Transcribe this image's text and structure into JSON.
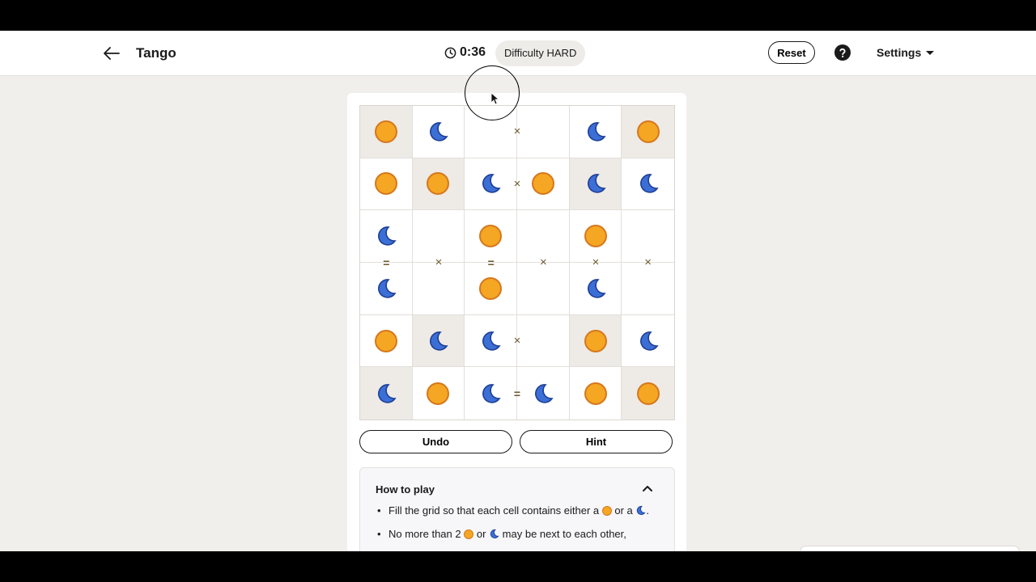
{
  "header": {
    "title": "Tango",
    "timer": "0:36",
    "difficulty": "Difficulty HARD",
    "reset_label": "Reset",
    "settings_label": "Settings"
  },
  "board": {
    "size": 6,
    "cells": [
      [
        {
          "v": "sun",
          "locked": true
        },
        {
          "v": "moon",
          "locked": false
        },
        {
          "v": "",
          "locked": false
        },
        {
          "v": "",
          "locked": false
        },
        {
          "v": "moon",
          "locked": false
        },
        {
          "v": "sun",
          "locked": true
        }
      ],
      [
        {
          "v": "sun",
          "locked": false
        },
        {
          "v": "sun",
          "locked": true
        },
        {
          "v": "moon",
          "locked": false
        },
        {
          "v": "sun",
          "locked": false
        },
        {
          "v": "moon",
          "locked": true
        },
        {
          "v": "moon",
          "locked": false
        }
      ],
      [
        {
          "v": "moon",
          "locked": false
        },
        {
          "v": "",
          "locked": false
        },
        {
          "v": "sun",
          "locked": false
        },
        {
          "v": "",
          "locked": false
        },
        {
          "v": "sun",
          "locked": false
        },
        {
          "v": "",
          "locked": false
        }
      ],
      [
        {
          "v": "moon",
          "locked": false
        },
        {
          "v": "",
          "locked": false
        },
        {
          "v": "sun",
          "locked": false
        },
        {
          "v": "",
          "locked": false
        },
        {
          "v": "moon",
          "locked": false
        },
        {
          "v": "",
          "locked": false
        }
      ],
      [
        {
          "v": "sun",
          "locked": false
        },
        {
          "v": "moon",
          "locked": true
        },
        {
          "v": "moon",
          "locked": false
        },
        {
          "v": "",
          "locked": false
        },
        {
          "v": "sun",
          "locked": true
        },
        {
          "v": "moon",
          "locked": false
        }
      ],
      [
        {
          "v": "moon",
          "locked": true
        },
        {
          "v": "sun",
          "locked": false
        },
        {
          "v": "moon",
          "locked": false
        },
        {
          "v": "moon",
          "locked": false
        },
        {
          "v": "sun",
          "locked": false
        },
        {
          "v": "sun",
          "locked": true
        }
      ]
    ],
    "constraints": [
      {
        "row": 0,
        "col": 2,
        "dir": "right",
        "type": "cross"
      },
      {
        "row": 1,
        "col": 2,
        "dir": "right",
        "type": "cross"
      },
      {
        "row": 2,
        "col": 0,
        "dir": "down",
        "type": "equal"
      },
      {
        "row": 2,
        "col": 1,
        "dir": "down",
        "type": "cross"
      },
      {
        "row": 2,
        "col": 2,
        "dir": "down",
        "type": "equal"
      },
      {
        "row": 2,
        "col": 3,
        "dir": "down",
        "type": "cross"
      },
      {
        "row": 2,
        "col": 4,
        "dir": "down",
        "type": "cross"
      },
      {
        "row": 2,
        "col": 5,
        "dir": "down",
        "type": "cross"
      },
      {
        "row": 4,
        "col": 2,
        "dir": "right",
        "type": "cross"
      },
      {
        "row": 5,
        "col": 2,
        "dir": "right",
        "type": "equal"
      }
    ]
  },
  "buttons": {
    "undo": "Undo",
    "hint": "Hint"
  },
  "how_to_play": {
    "title": "How to play",
    "rule1_part1": "Fill the grid so that each cell contains either a",
    "rule1_part2": "or a",
    "rule1_end": ".",
    "rule2_part1": "No more than 2",
    "rule2_part2": "or",
    "rule2_part3": "may be next to each other,"
  },
  "colors": {
    "sun_fill": "#f5a623",
    "sun_border": "#d5781d",
    "moon_fill": "#3b6fd6",
    "moon_border": "#1e3f96",
    "locked_cell": "#eeeae6",
    "sign_color": "#6b5a2e"
  },
  "icons": {
    "back": "arrow-left-icon",
    "timer": "clock-icon",
    "help": "question-circle-icon",
    "settings_caret": "caret-down-icon",
    "collapse": "chevron-up-icon"
  }
}
